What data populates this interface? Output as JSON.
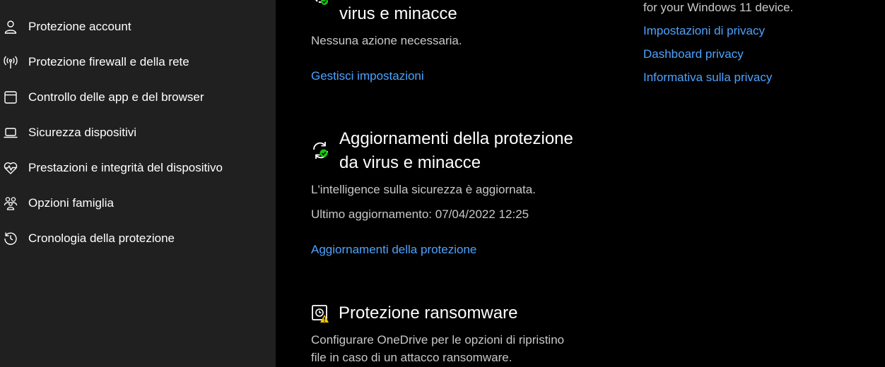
{
  "sidebar": {
    "items": [
      {
        "label": "Protezione account",
        "icon": "person-icon"
      },
      {
        "label": "Protezione firewall e della rete",
        "icon": "antenna-icon"
      },
      {
        "label": "Controllo delle app e del browser",
        "icon": "app-window-icon"
      },
      {
        "label": "Sicurezza dispositivi",
        "icon": "laptop-icon"
      },
      {
        "label": "Prestazioni e integrità del dispositivo",
        "icon": "heart-pulse-icon"
      },
      {
        "label": "Opzioni famiglia",
        "icon": "family-icon"
      },
      {
        "label": "Cronologia della protezione",
        "icon": "history-icon"
      }
    ]
  },
  "sections": {
    "threat_settings": {
      "heading_tail": "virus e minacce",
      "status": "Nessuna azione necessaria.",
      "link": "Gestisci impostazioni"
    },
    "updates": {
      "heading_line1": "Aggiornamenti della protezione",
      "heading_line2": "da virus e minacce",
      "status": "L'intelligence sulla sicurezza è aggiornata.",
      "last_update": "Ultimo aggiornamento: 07/04/2022 12:25",
      "link": "Aggiornamenti della protezione"
    },
    "ransomware": {
      "heading": "Protezione ransomware",
      "desc_line1": "Configurare OneDrive per le opzioni di ripristino",
      "desc_line2": "file in caso di un attacco ransomware."
    }
  },
  "privacy": {
    "intro_tail": "for your Windows 11 device.",
    "links": [
      "Impostazioni di privacy",
      "Dashboard privacy",
      "Informativa sulla privacy"
    ]
  },
  "colors": {
    "link": "#4da3ff",
    "ok_badge": "#16c60c",
    "warn_badge": "#f7c600",
    "sidebar_bg": "#202020"
  }
}
